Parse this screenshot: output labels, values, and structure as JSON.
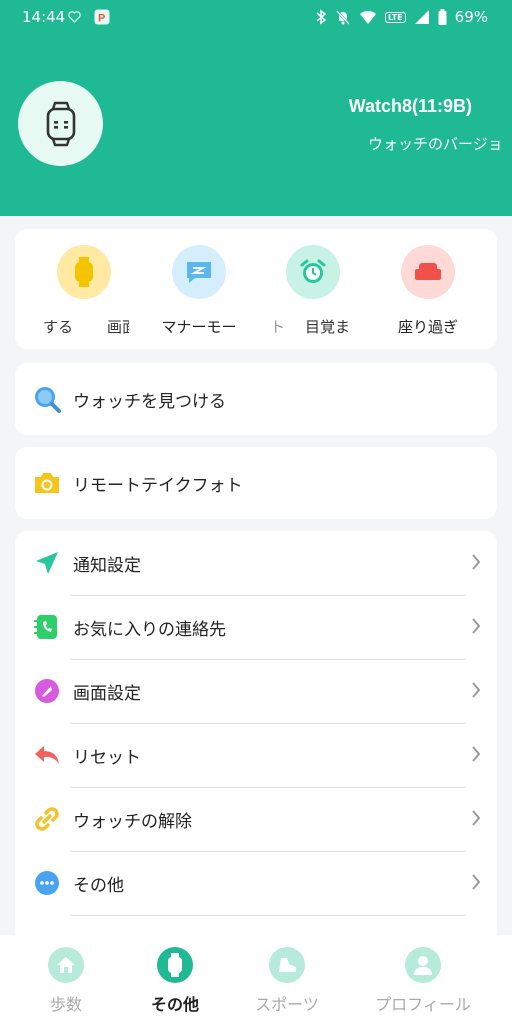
{
  "status_bar": {
    "time": "14:44",
    "battery": "69%",
    "lte_badge": "LTE",
    "left_icons": [
      "heart-icon",
      "p-app-icon"
    ],
    "right_icons": [
      "bluetooth-icon",
      "mute-bell-icon",
      "wifi-icon",
      "volte-icon",
      "signal-icon",
      "battery-icon"
    ]
  },
  "header": {
    "device_name": "Watch8(11:9B)",
    "version_text": "ウォッチのバージョ",
    "background_color": "#1fba93"
  },
  "quick_actions": {
    "left_fragment": "する",
    "fragment_2": "画面",
    "fragment_3": "ト",
    "fragment_4": "目覚ま",
    "items": [
      {
        "label": "",
        "icon": "watch-icon",
        "color": "#ffe9a3"
      },
      {
        "label": "マナーモー",
        "icon": "message-off-icon",
        "color": "#d5eefc"
      },
      {
        "label": "",
        "icon": "alarm-clock-icon",
        "color": "#c9f2e6"
      },
      {
        "label": "座り過ぎ",
        "icon": "sofa-icon",
        "color": "#ffd9d6"
      }
    ]
  },
  "find_watch": {
    "label": "ウォッチを見つける",
    "icon": "search-icon"
  },
  "remote_photo": {
    "label": "リモートテイクフォト",
    "icon": "camera-icon"
  },
  "settings_list": [
    {
      "label": "通知設定",
      "icon": "send-icon"
    },
    {
      "label": "お気に入りの連絡先",
      "icon": "phone-contact-icon"
    },
    {
      "label": "画面設定",
      "icon": "screen-dial-icon"
    },
    {
      "label": "リセット",
      "icon": "reset-arrow-icon"
    },
    {
      "label": "ウォッチの解除",
      "icon": "unlink-icon"
    },
    {
      "label": "その他",
      "icon": "more-icon"
    }
  ],
  "bottom_nav": {
    "active": "その他",
    "items": [
      {
        "label": "歩数",
        "icon": "home-icon"
      },
      {
        "label": "その他",
        "icon": "watch-nav-icon"
      },
      {
        "label": "スポーツ",
        "icon": "shoe-icon"
      },
      {
        "label": "プロフィール",
        "icon": "person-icon"
      }
    ]
  }
}
